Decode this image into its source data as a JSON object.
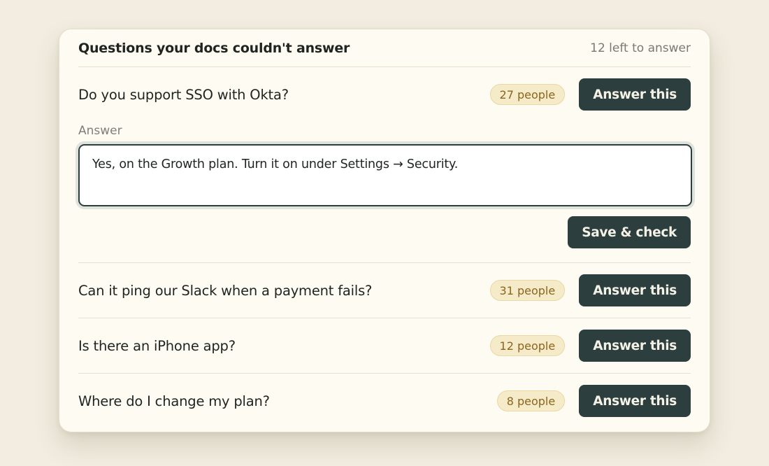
{
  "panel": {
    "title": "Questions your docs couldn't answer",
    "remaining": "12 left to answer"
  },
  "questions": [
    {
      "text": "Do you support SSO with Okta?",
      "people": "27 people",
      "action": "Answer this"
    },
    {
      "text": "Can it ping our Slack when a payment fails?",
      "people": "31 people",
      "action": "Answer this"
    },
    {
      "text": "Is there an iPhone app?",
      "people": "12 people",
      "action": "Answer this"
    },
    {
      "text": "Where do I change my plan?",
      "people": "8 people",
      "action": "Answer this"
    }
  ],
  "answer_editor": {
    "label": "Answer",
    "value": "Yes, on the Growth plan. Turn it on under Settings → Security.",
    "submit_label": "Save & check"
  },
  "colors": {
    "page_background": "#f2ede0",
    "card_background": "#fdfbf2",
    "button": "#2d3e3e",
    "badge_background": "#f6ebc8",
    "badge_text": "#8a651f"
  }
}
